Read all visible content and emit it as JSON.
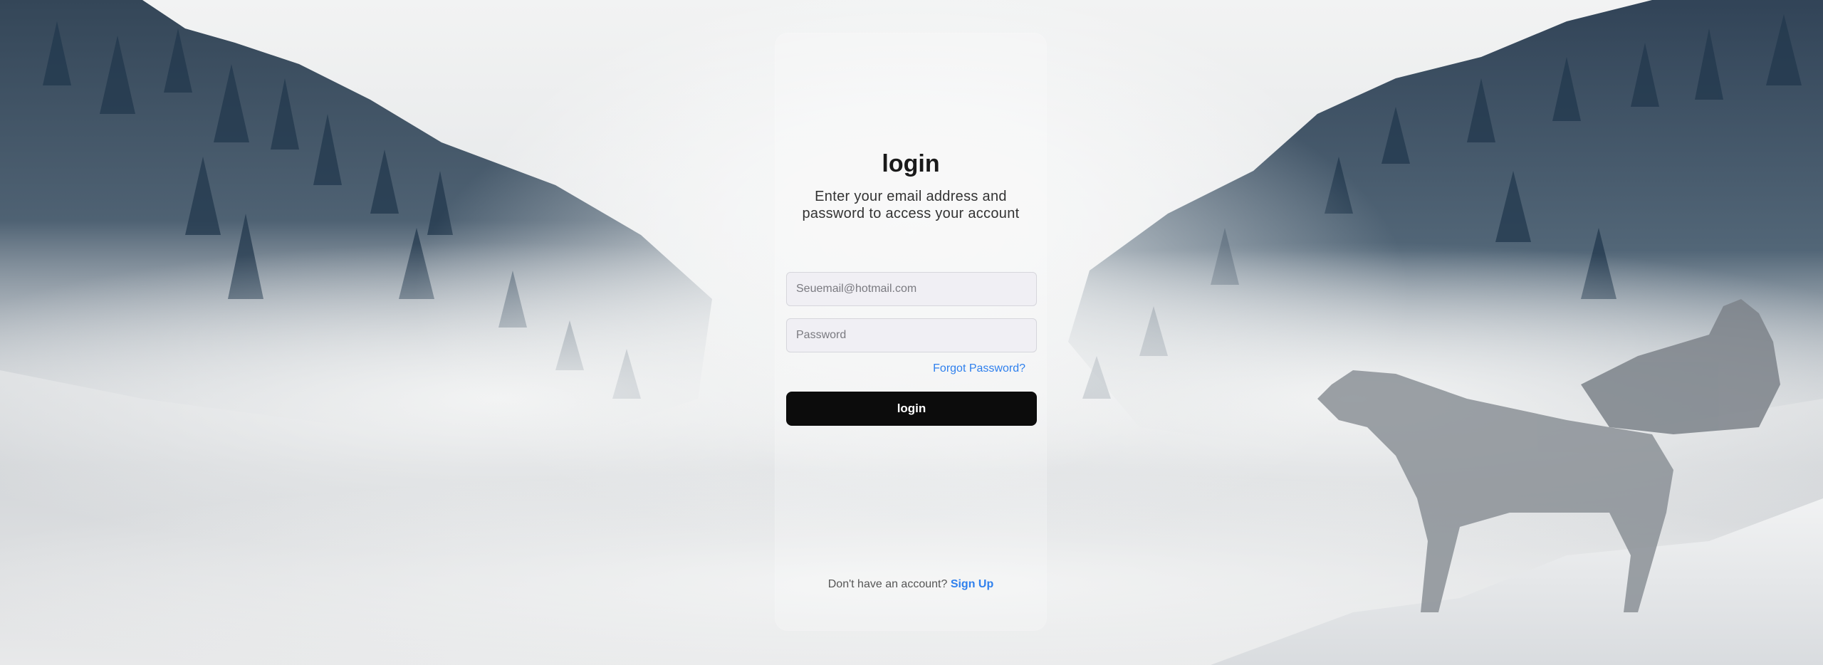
{
  "login": {
    "title": "login",
    "subtitle": "Enter your email address and password to access your account",
    "email_placeholder": "Seuemail@hotmail.com",
    "password_placeholder": "Password",
    "forgot_password": "Forgot Password?",
    "login_button": "login",
    "signup_prompt": "Don't have an account?",
    "signup_link": "Sign Up"
  },
  "colors": {
    "accent": "#2f80ed",
    "button": "#0c0c0c",
    "input_bg": "#f0eff4"
  }
}
